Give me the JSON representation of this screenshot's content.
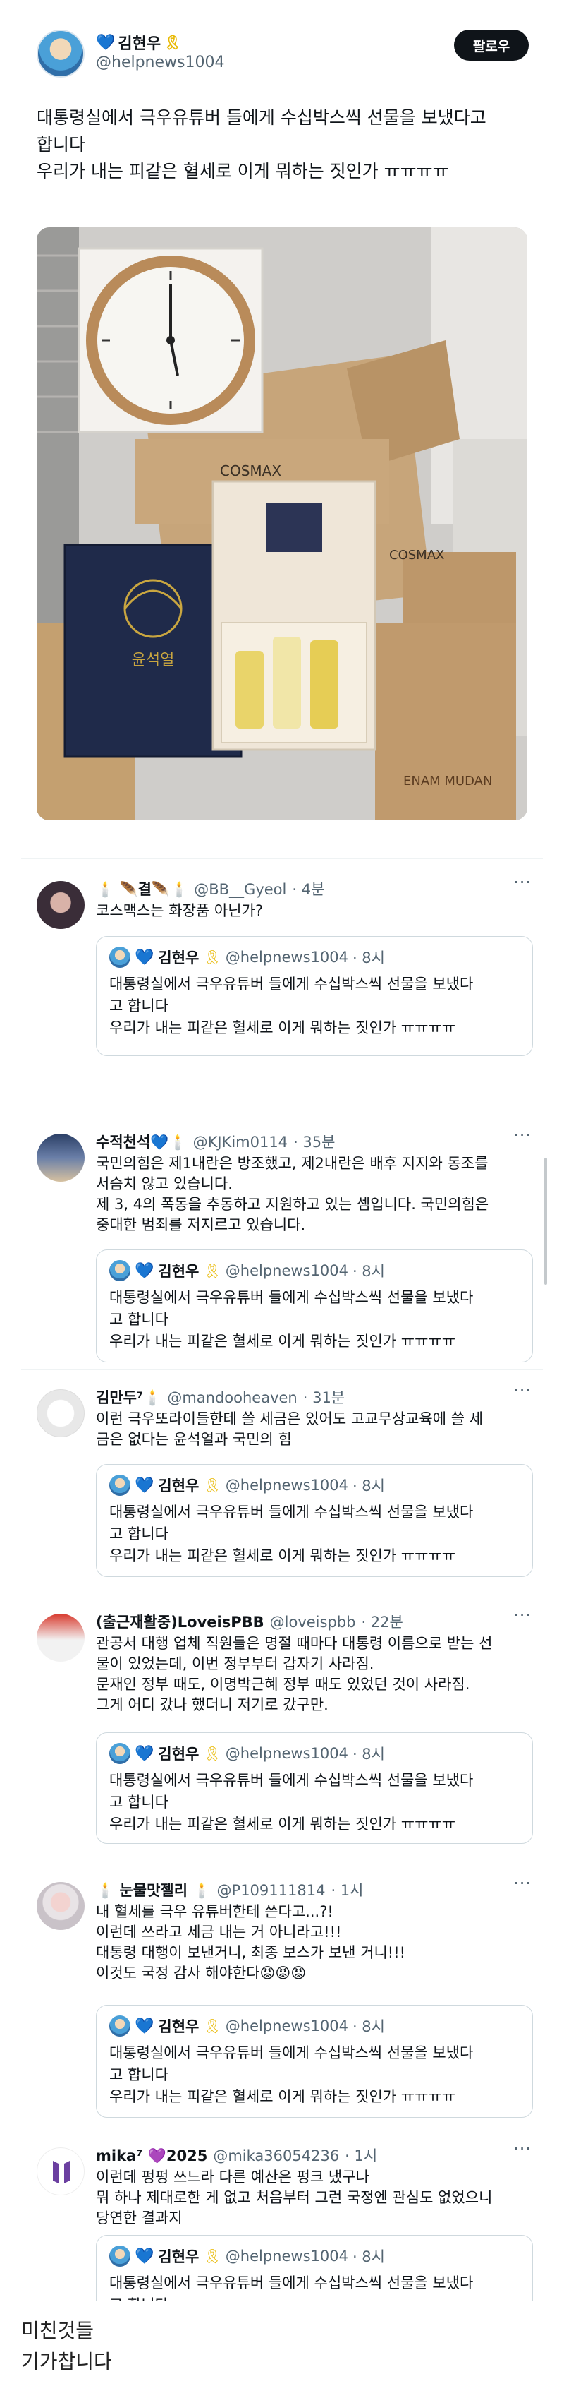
{
  "main_tweet": {
    "author_name": "김현우",
    "author_handle": "@helpnews1004",
    "follow_label": "팔로우",
    "text_line1": "대통령실에서 극우유튜버 들에게 수십박스씩 선물을 보냈다고",
    "text_line2": "합니다",
    "text_line3": "우리가 내는 피같은 혈세로 이게 뭐하는 짓인가 ㅠㅠㅠㅠ",
    "photo_texts": {
      "box_brand": "COSMAX",
      "box_brand2": "COSMAX",
      "signature": "윤석열",
      "box_side": "ENAM MUDAN"
    }
  },
  "quote": {
    "name": "김현우",
    "handle": "@helpnews1004",
    "time": "· 8시",
    "line1": "대통령실에서 극우유튜버 들에게 수십박스씩 선물을 보냈다",
    "line2": "고 합니다",
    "line3": "우리가 내는 피같은 혈세로 이게 뭐하는 짓인가 ㅠㅠㅠㅠ"
  },
  "replies": [
    {
      "name": "🕯️ 🪶결🪶🕯️",
      "handle": "@BB__Gyeol",
      "time": "· 4분",
      "text": "코스맥스는 화장품 아닌가?"
    },
    {
      "name": "수적천석💙🕯️",
      "handle": "@KJKim0114",
      "time": "· 35분",
      "text": "국민의힘은 제1내란은 방조했고, 제2내란은 배후 지지와 동조를\n서슴치 않고 있습니다.\n제 3, 4의 폭동을 추동하고 지원하고 있는 셈입니다. 국민의힘은\n중대한 범죄를 저지르고 있습니다."
    },
    {
      "name": "김만두⁷🕯️",
      "handle": "@mandooheaven",
      "time": "· 31분",
      "text": "이런 극우또라이들한테 쓸 세금은 있어도 고교무상교육에 쓸 세\n금은 없다는 윤석열과 국민의 힘"
    },
    {
      "name": "(출근재활중)LoveisPBB",
      "handle": "@loveispbb",
      "time": "· 22분",
      "text": "관공서 대행 업체 직원들은 명절 때마다 대통령 이름으로 받는 선\n물이 있었는데, 이번 정부부터 갑자기 사라짐.\n문재인 정부 때도, 이명박근혜 정부 때도 있었던 것이 사라짐.\n그게 어디 갔나 했더니 저기로 갔구만."
    },
    {
      "name": "🕯️ 눈물맛젤리 🕯️",
      "handle": "@P109111814",
      "time": "· 1시",
      "text": "내 혈세를 극우 유튜버한테 쓴다고...?!\n이런데 쓰라고 세금 내는 거 아니라고!!!\n대통령 대행이 보낸거니, 최종 보스가 보낸 거니!!!\n이것도 국정 감사 해야한다😡😡😡"
    },
    {
      "name": "mika⁷ 💜2025",
      "handle": "@mika36054236",
      "time": "· 1시",
      "text": "이런데 펑펑 쓰느라 다른 예산은 펑크 냈구나\n뭐 하나 제대로한 게 없고 처음부터 그런 국정엔 관심도 없었으니\n당연한 결과지"
    }
  ],
  "more_label": "···",
  "caption": {
    "line1": "미친것들",
    "line2": "기가찹니다"
  }
}
